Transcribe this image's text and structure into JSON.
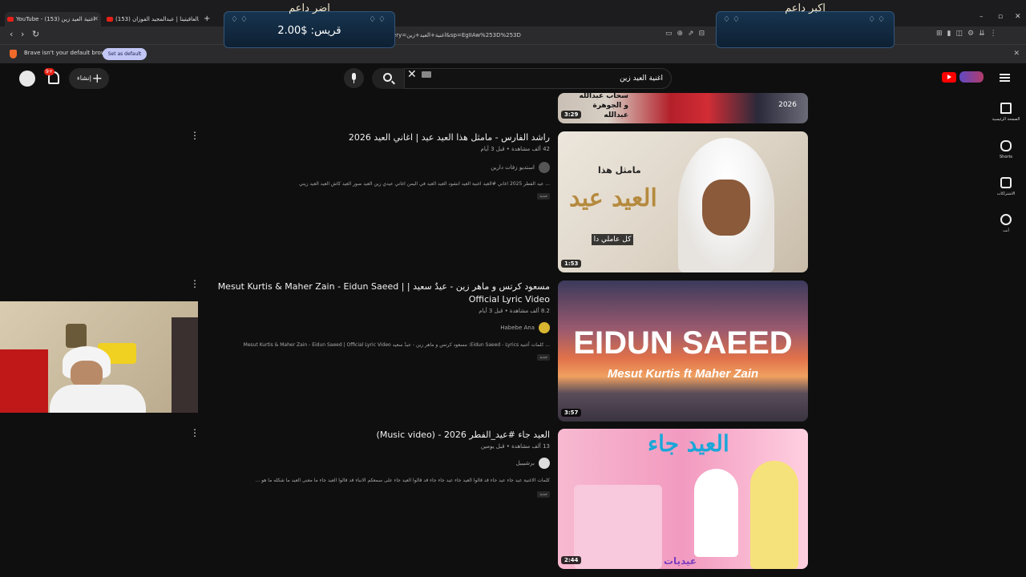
{
  "browser": {
    "tabs": [
      {
        "label": "YouTube - اغنية العيد زين (153)"
      },
      {
        "label": "عيد بالعافيتينا | عبدالمجيد الفوزان (153)"
      }
    ],
    "new_tab": "+",
    "url": "ery=اغنية+العيد+زين&sp=EgIIAw%253D%253D",
    "default_notice": "Brave isn't your default browser",
    "set_default_label": "Set as default"
  },
  "overlay": {
    "left_heading": "اضر داعم",
    "left_value": "قريس: $2.00",
    "right_heading": "اكبر داعم"
  },
  "youtube": {
    "search_query": "اغنية العيد زين",
    "create_label": "إنشاء",
    "notification_count": "9+",
    "sidebar": [
      {
        "label": "الصفحة الرئيسية"
      },
      {
        "label": "Shorts"
      },
      {
        "label": "الاشتراكات"
      },
      {
        "label": "أنت"
      }
    ]
  },
  "results": [
    {
      "title": "",
      "duration": "3:29",
      "thumb_text": "سحاب عبدالله و الجوهرة عبدالله",
      "thumb_year": "2026"
    },
    {
      "title": "راشد الفارس - مامثل هذا العيد عيد | اغاني العيد 2026",
      "meta": "42 ألف مشاهدة • قبل 3 أيام",
      "channel": "استديو زفات دارين",
      "description": "... عيد الفطر 2025 اغاني #العيد اغنية العيد انشود العيد العيد في اليمن اغاني عيدي زين العيد صور العيد كاش العيد العيد زيني",
      "badge": "جديد",
      "duration": "1:53",
      "thumb_line1": "مامثل هذا",
      "thumb_line2": "العيد عيد",
      "thumb_caption": "كل عاملي دا"
    },
    {
      "title": "مسعود كرتس و ماهر زين - عيدٌ سعيد | Mesut Kurtis & Maher Zain - Eidun Saeed | Official Lyric Video",
      "meta": "8.2 ألف مشاهدة • قبل 3 أيام",
      "channel": "Habebe Ana",
      "description": "... كلمات أغنية Eidun Saeed - Lyrics: مسعود كرتس و ماهر زين - عيدٌ سعيد Mesut Kurtis & Maher Zain - Eidun Saeed | Official Lyric Video",
      "badge": "جديد",
      "duration": "3:57",
      "thumb_title": "EIDUN SAEED",
      "thumb_sub": "Mesut Kurtis ft Maher Zain"
    },
    {
      "title": "العيد جاء #عيد_الفطر 2026 - (Music video)",
      "meta": "13 ألف مشاهدة • قبل يومين",
      "channel": "برشيبيل",
      "description": "كلمات الاغنية عيد جاء عيد جاء قد قالوا العيد جاء عيد جاء جاء قد قالوا العيد جاء على سمعكم الانباء قد قالوا العيد جاء ما معنى العيد ما شكله ما هو ...",
      "badge": "جديد",
      "duration": "2:44",
      "thumb_title": "العيد جاء",
      "thumb_corner": "عيديات"
    }
  ],
  "colors": {
    "background": "#0f0f0f",
    "youtube_red": "#ff0000",
    "brave_orange": "#f06a2a",
    "set_default_button": "#c2c6f5"
  }
}
